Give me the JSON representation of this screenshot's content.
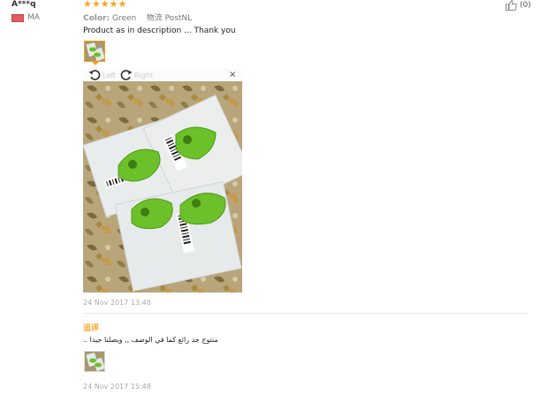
{
  "reviewer": {
    "name": "A***q",
    "country_code": "MA",
    "flag_color": "#e35b5b"
  },
  "rating": {
    "stars": 5,
    "display": "★★★★★"
  },
  "meta": {
    "color_label": "Color:",
    "color_value": "Green",
    "shipping_label": "物流",
    "shipping_value": "PostNL"
  },
  "helpful": {
    "count_text": "(0)"
  },
  "review": {
    "text": "Product as in description ... Thank you",
    "date": "24 Nov 2017 13:48"
  },
  "viewer": {
    "rotate_left": "Left",
    "rotate_right": "Right",
    "close": "×"
  },
  "additional": {
    "label": "追评",
    "text": ".. منتوج جد رائع كما في الوصف ,, ويصلنا جيدا",
    "date": "24 Nov 2017 15:48"
  },
  "colors": {
    "accent": "#f5a623",
    "thumb_border": "#f59e1a",
    "product_green": "#6cc02a"
  }
}
